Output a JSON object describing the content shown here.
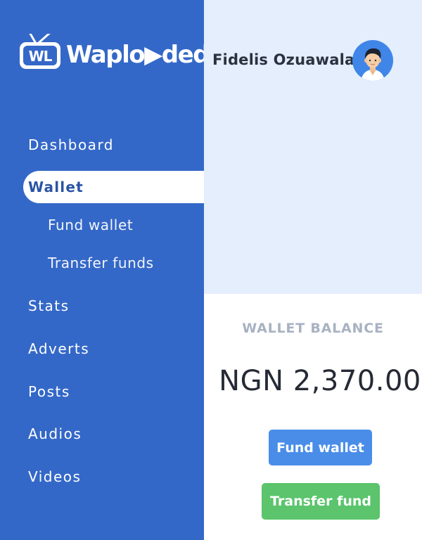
{
  "brand": {
    "name": "Waploaded",
    "logo_text": "Waplo▶ded",
    "badge_text": "WL"
  },
  "user": {
    "name": "Fidelis Ozuawala"
  },
  "nav": {
    "dashboard": "Dashboard",
    "wallet": "Wallet",
    "fund_wallet": "Fund wallet",
    "transfer_funds": "Transfer funds",
    "stats": "Stats",
    "adverts": "Adverts",
    "posts": "Posts",
    "audios": "Audios",
    "videos": "Videos",
    "active": "Wallet"
  },
  "wallet": {
    "balance_label": "WALLET BALANCE",
    "balance_value": "NGN 2,370.00",
    "fund_button": "Fund wallet",
    "transfer_button": "Transfer fund"
  },
  "colors": {
    "sidebar": "#3468c8",
    "header_bg": "#e4eefc",
    "fund_button": "#4a8de9",
    "transfer_button": "#5bc46c"
  },
  "icons": {
    "avatar": "user-avatar-icon",
    "logo": "tv-antenna-logo-icon"
  }
}
